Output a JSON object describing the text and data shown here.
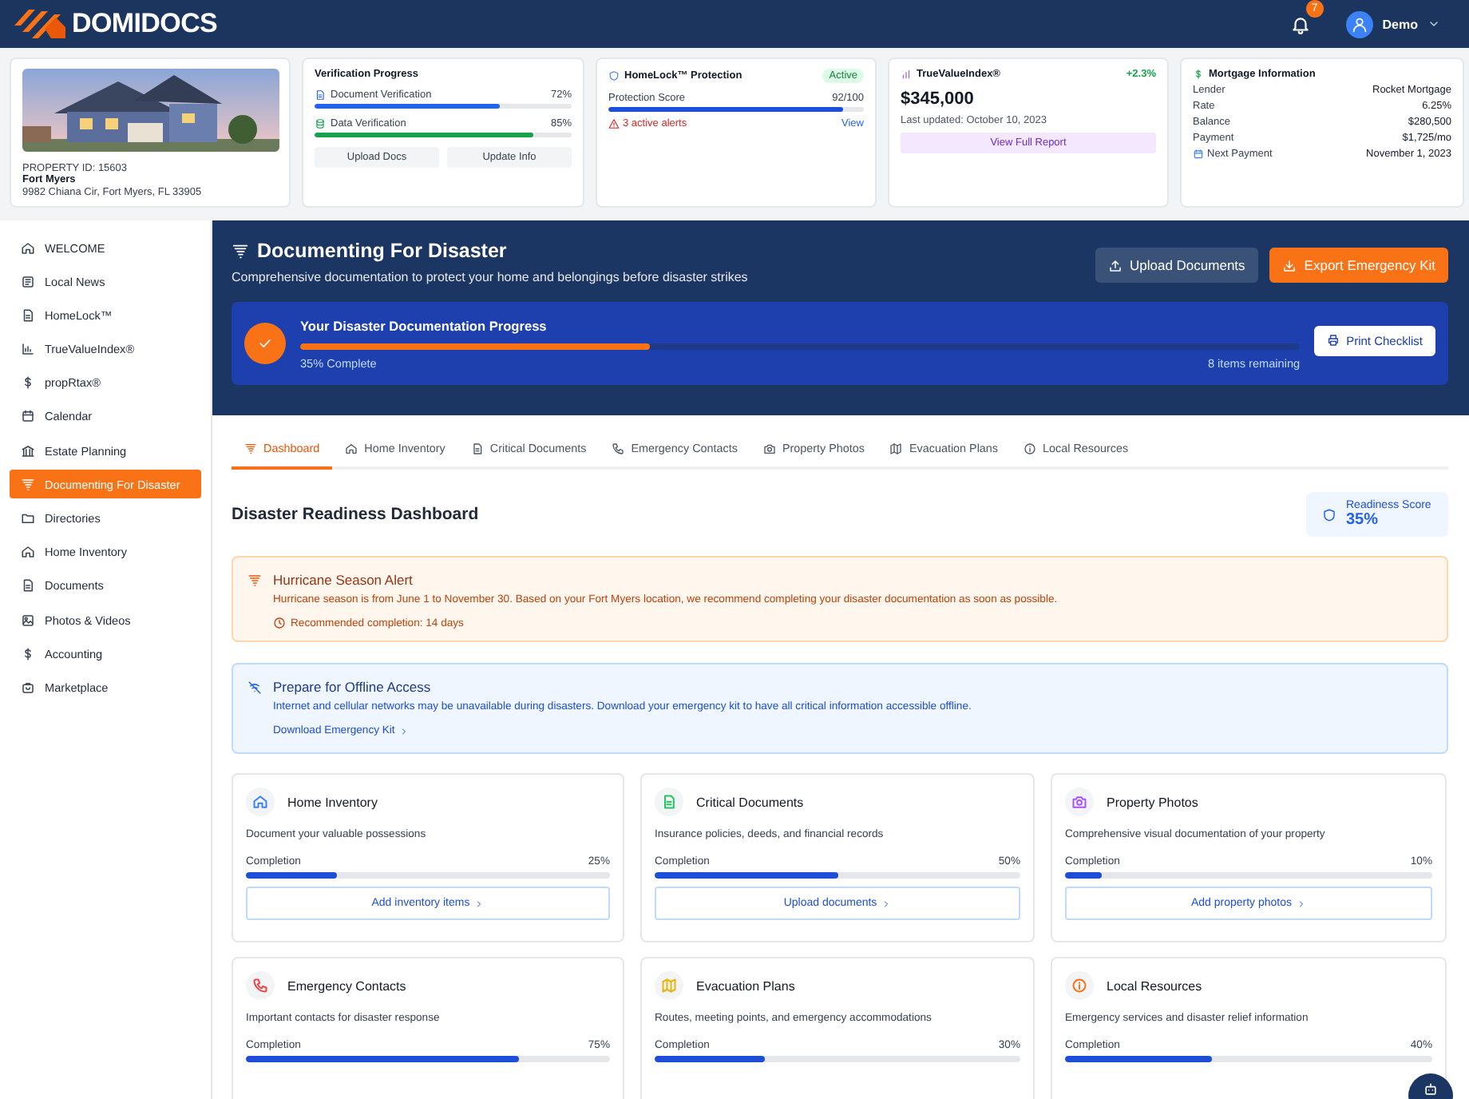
{
  "header": {
    "logo": "DOMIDOCS",
    "notifications": "7",
    "user": "Demo"
  },
  "summary": {
    "property": {
      "kind": "picture",
      "id": "PROPERTY ID: 15603",
      "city": "Fort Myers",
      "address": "9982 Chiana Cir, Fort Myers, FL 33905"
    },
    "verification": {
      "title": "Verification Progress",
      "items": [
        {
          "label": "Document Verification",
          "value": "72%",
          "level": 0.72,
          "color": "#2563eb"
        },
        {
          "label": "Data Verification",
          "value": "85%",
          "level": 0.85,
          "color": "#16a34a"
        }
      ],
      "buttons": [
        "Upload Docs",
        "Update Info"
      ]
    },
    "homelock": {
      "title": "HomeLock™ Protection",
      "badge": "Active",
      "label": "Protection Score",
      "score": "92/100",
      "level": 0.92,
      "alerts": "3 active alerts",
      "link": "View"
    },
    "value_index": {
      "title": "TrueValueIndex®",
      "change": "+2.3%",
      "value": "$345,000",
      "updated": "Last updated: October 10, 2023",
      "button": "View Full Report"
    },
    "mortgage": {
      "title": "Mortgage Information",
      "rows": [
        {
          "label": "Lender",
          "value": "Rocket Mortgage"
        },
        {
          "label": "Rate",
          "value": "6.25%"
        },
        {
          "label": "Balance",
          "value": "$280,500"
        },
        {
          "label": "Payment",
          "value": "$1,725/mo"
        }
      ],
      "next_payment": {
        "label": "Next Payment",
        "value": "November 1, 2023"
      }
    }
  },
  "sidebar": {
    "items": [
      {
        "label": "WELCOME",
        "selected": false
      },
      {
        "label": "Local News",
        "selected": false
      },
      {
        "label": "HomeLock™",
        "selected": false
      },
      {
        "label": "TrueValueIndex®",
        "selected": false
      },
      {
        "label": "propRtax®",
        "selected": false
      },
      {
        "label": "Calendar",
        "selected": false
      },
      {
        "label": "Estate Planning",
        "selected": false
      },
      {
        "label": "Documenting For Disaster",
        "selected": true
      },
      {
        "label": "Directories",
        "selected": false
      },
      {
        "label": "Home Inventory",
        "selected": false
      },
      {
        "label": "Documents",
        "selected": false
      },
      {
        "label": "Photos & Videos",
        "selected": false
      },
      {
        "label": "Accounting",
        "selected": false
      },
      {
        "label": "Marketplace",
        "selected": false
      }
    ]
  },
  "hero": {
    "title": "Documenting For Disaster",
    "subtitle": "Comprehensive documentation to protect your home and belongings before disaster strikes",
    "buttons": [
      "Upload Documents",
      "Export Emergency Kit"
    ],
    "progress": {
      "title": "Your Disaster Documentation Progress",
      "level": 0.35,
      "complete": "35% Complete",
      "remaining": "8 items remaining",
      "button": "Print Checklist"
    }
  },
  "tabs": [
    {
      "label": "Dashboard",
      "selected": true
    },
    {
      "label": "Home Inventory",
      "selected": false
    },
    {
      "label": "Critical Documents",
      "selected": false
    },
    {
      "label": "Emergency Contacts",
      "selected": false
    },
    {
      "label": "Property Photos",
      "selected": false
    },
    {
      "label": "Evacuation Plans",
      "selected": false
    },
    {
      "label": "Local Resources",
      "selected": false
    }
  ],
  "dashboard": {
    "title": "Disaster Readiness Dashboard",
    "readiness": {
      "label": "Readiness Score",
      "value": "35%"
    },
    "alert": {
      "title": "Hurricane Season Alert",
      "text": "Hurricane season is from June 1 to November 30. Based on your Fort Myers location, we recommend completing your disaster documentation as soon as possible.",
      "note": "Recommended completion: 14 days"
    },
    "offline": {
      "title": "Prepare for Offline Access",
      "text": "Internet and cellular networks may be unavailable during disasters. Download your emergency kit to have all critical information accessible offline.",
      "link": "Download Emergency Kit"
    },
    "cards": [
      {
        "title": "Home Inventory",
        "color": "#3b82f6",
        "description": "Document your valuable possessions",
        "label": "Completion",
        "value": "25%",
        "level": 0.25,
        "action": "Add inventory items"
      },
      {
        "title": "Critical Documents",
        "color": "#22c55e",
        "description": "Insurance policies, deeds, and financial records",
        "label": "Completion",
        "value": "50%",
        "level": 0.5,
        "action": "Upload documents"
      },
      {
        "title": "Property Photos",
        "color": "#a855f7",
        "description": "Comprehensive visual documentation of your property",
        "label": "Completion",
        "value": "10%",
        "level": 0.1,
        "action": "Add property photos"
      },
      {
        "title": "Emergency Contacts",
        "color": "#ef4444",
        "description": "Important contacts for disaster response",
        "label": "Completion",
        "value": "75%",
        "level": 0.75
      },
      {
        "title": "Evacuation Plans",
        "color": "#eab308",
        "description": "Routes, meeting points, and emergency accommodations",
        "label": "Completion",
        "value": "30%",
        "level": 0.3
      },
      {
        "title": "Local Resources",
        "color": "#f97316",
        "description": "Emergency services and disaster relief information",
        "label": "Completion",
        "value": "40%",
        "level": 0.4
      }
    ]
  }
}
